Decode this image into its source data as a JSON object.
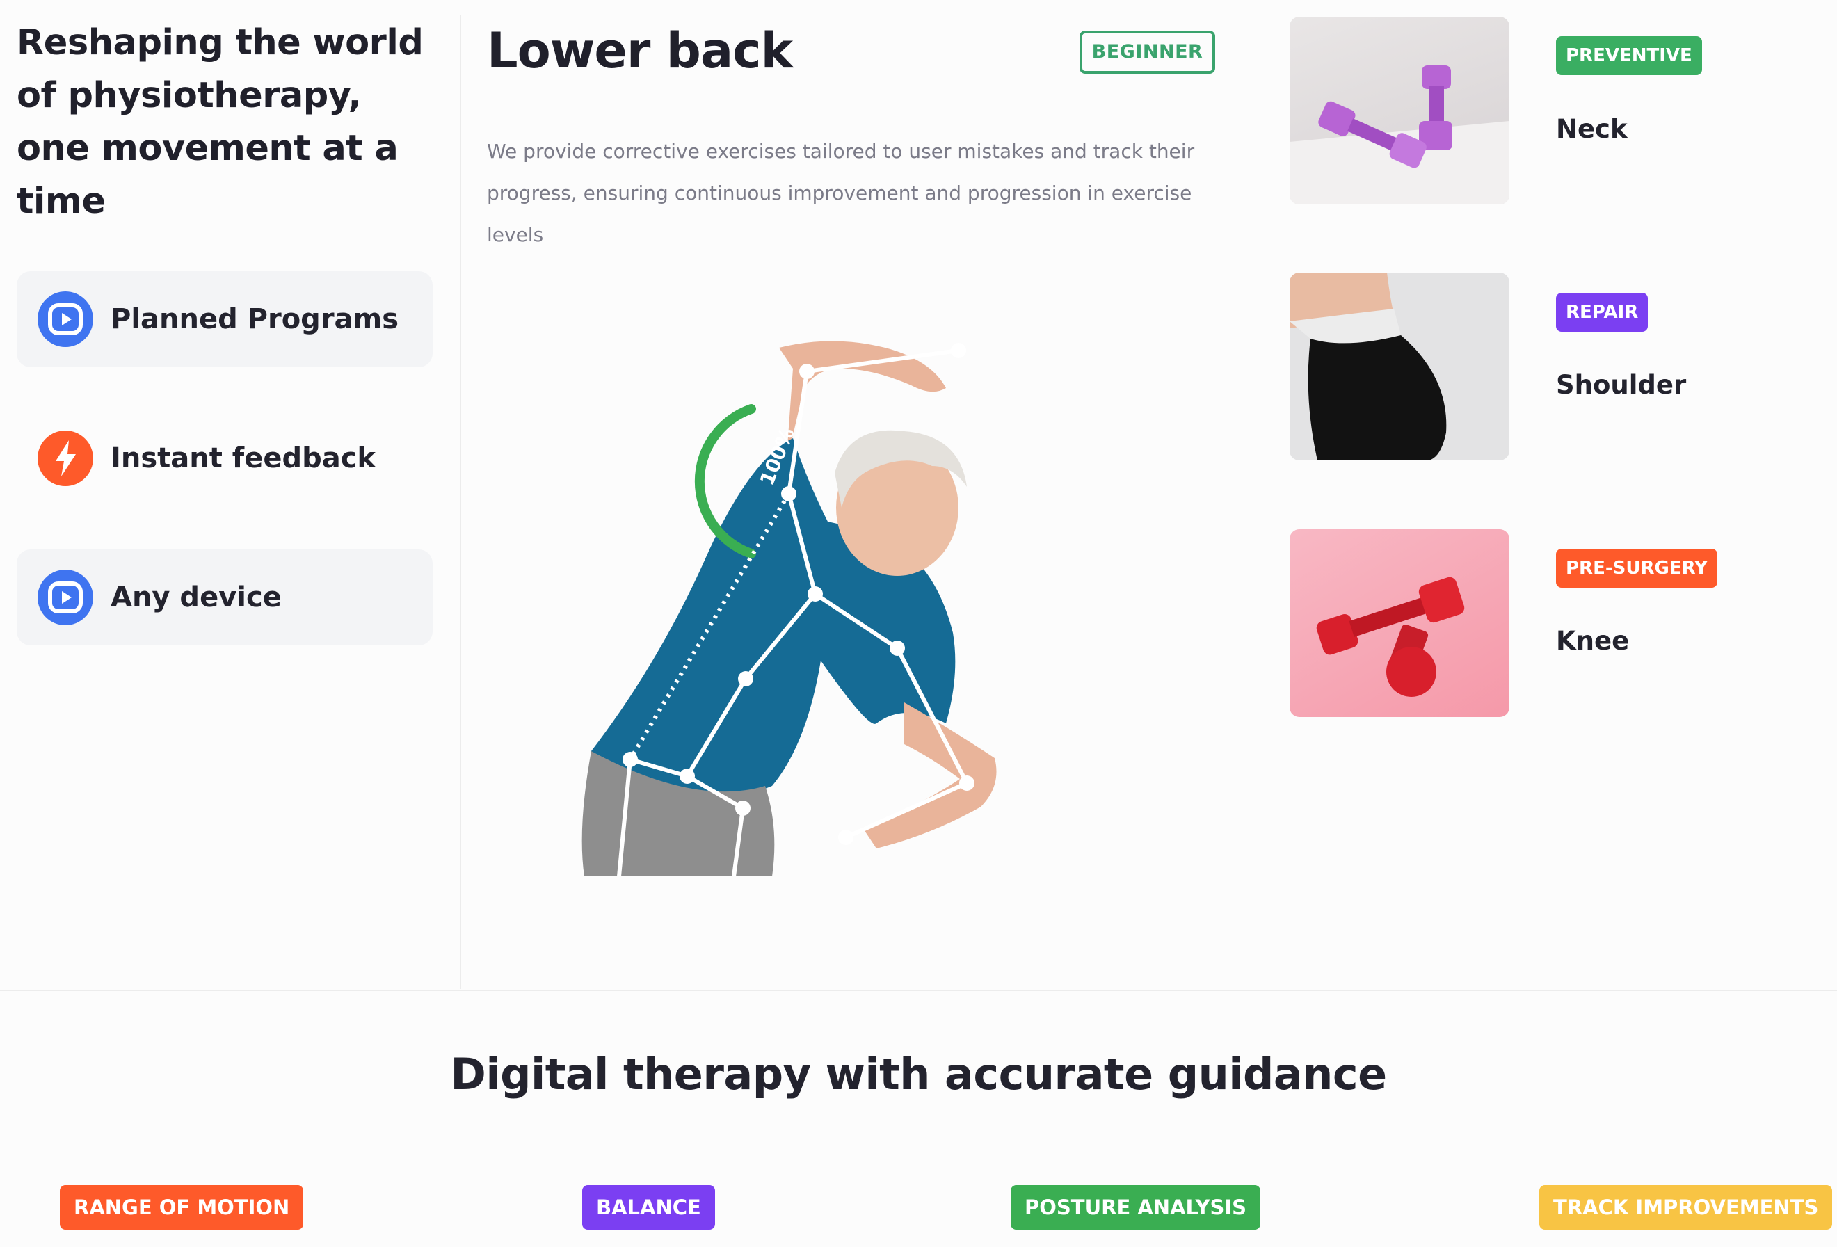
{
  "hero": {
    "tagline": "Reshaping the world of physiotherapy, one movement at a time",
    "features": [
      {
        "label": "Planned Programs",
        "icon": "play-icon",
        "color": "#3f74f0"
      },
      {
        "label": "Instant feedback",
        "icon": "lightning-icon",
        "color": "#fe5a2a"
      },
      {
        "label": "Any device",
        "icon": "play-icon",
        "color": "#3f74f0"
      }
    ]
  },
  "exercise": {
    "title": "Lower back",
    "level": "BEGINNER",
    "level_color": "#3aa36d",
    "description": "We provide corrective exercises tailored to user mistakes and track their progress, ensuring continuous improvement and progression in exercise levels",
    "progress_label": "100%",
    "progress_color": "#3aae52"
  },
  "programs": [
    {
      "tag": "PREVENTIVE",
      "tag_color": "#3aae62",
      "name": "Neck",
      "image": "purple-dumbbells-image"
    },
    {
      "tag": "REPAIR",
      "tag_color": "#7b3ff2",
      "name": "Shoulder",
      "image": "leggings-image"
    },
    {
      "tag": "PRE-SURGERY",
      "tag_color": "#fe5a2a",
      "name": "Knee",
      "image": "red-dumbbells-image"
    }
  ],
  "guidance": {
    "title": "Digital therapy with accurate guidance",
    "tags": [
      {
        "label": "RANGE OF MOTION",
        "color": "#fe5a2a"
      },
      {
        "label": "BALANCE",
        "color": "#7b3ff2"
      },
      {
        "label": "POSTURE ANALYSIS",
        "color": "#3aae52"
      },
      {
        "label": "TRACK IMPROVEMENTS",
        "color": "#f8c444"
      }
    ]
  }
}
